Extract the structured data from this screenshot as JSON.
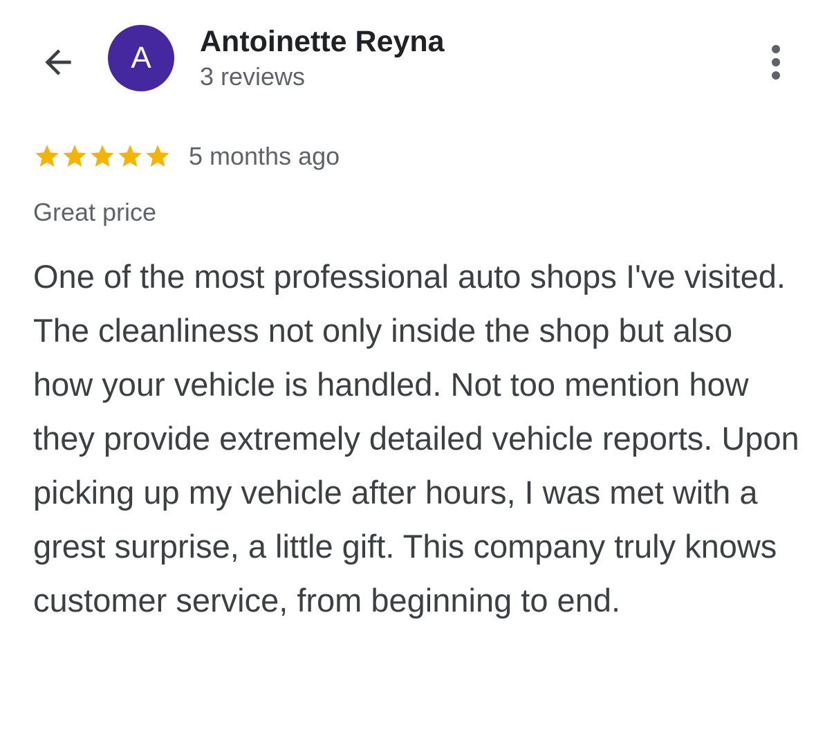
{
  "header": {
    "back_icon": "arrow-left-icon",
    "avatar_letter": "A",
    "avatar_color": "#4527a0",
    "author_name": "Antoinette Reyna",
    "review_count": "3 reviews",
    "more_icon": "more-vertical-icon"
  },
  "review": {
    "rating": 5,
    "rating_max": 5,
    "star_color": "#f4b400",
    "date": "5 months ago",
    "tag": "Great price",
    "text": "One of the most professional auto shops I've visited. The cleanliness not only inside the shop but also how your vehicle is handled. Not too mention how they provide extremely detailed vehicle reports. Upon picking up my vehicle after hours, I was met with a grest surprise, a little gift. This company truly knows customer service, from beginning to end."
  }
}
